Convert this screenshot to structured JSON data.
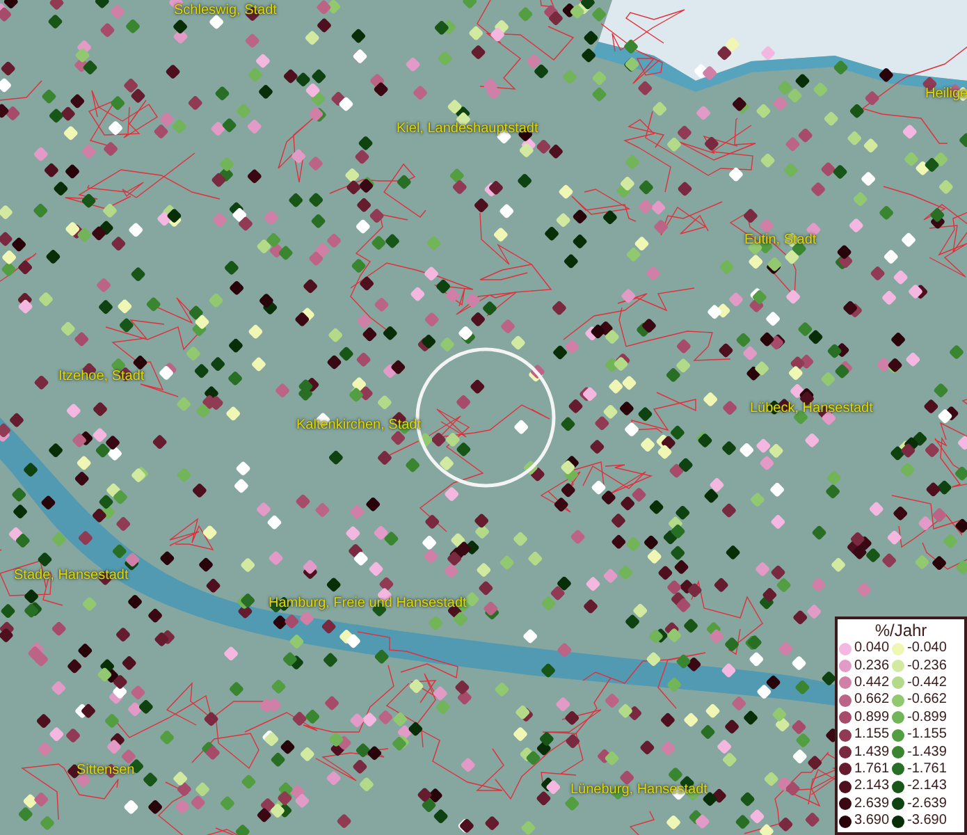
{
  "map": {
    "places": [
      {
        "name": "Schleswig, Stadt"
      },
      {
        "name": "Kiel, Landeshauptstadt"
      },
      {
        "name": "Heilige"
      },
      {
        "name": "Eutin, Stadt"
      },
      {
        "name": "Itzehoe, Stadt"
      },
      {
        "name": "Kaltenkirchen, Stadt"
      },
      {
        "name": "Lübeck, Hansestadt"
      },
      {
        "name": "Stade, Hansestadt"
      },
      {
        "name": "Hamburg, Freie und Hansestadt"
      },
      {
        "name": "Sittensen"
      },
      {
        "name": "Lüneburg, Hansestadt"
      }
    ]
  },
  "legend": {
    "title": "%/Jahr",
    "positive": [
      {
        "value": "0.040",
        "color": "#f4b8e0"
      },
      {
        "value": "0.236",
        "color": "#e29ac6"
      },
      {
        "value": "0.442",
        "color": "#d080a6"
      },
      {
        "value": "0.662",
        "color": "#bc6486"
      },
      {
        "value": "0.899",
        "color": "#a64c6a"
      },
      {
        "value": "1.155",
        "color": "#903a54"
      },
      {
        "value": "1.439",
        "color": "#7a2a40"
      },
      {
        "value": "1.761",
        "color": "#641c2e"
      },
      {
        "value": "2.143",
        "color": "#4e101e"
      },
      {
        "value": "2.639",
        "color": "#3a0812"
      },
      {
        "value": "3.690",
        "color": "#28040a"
      }
    ],
    "negative": [
      {
        "value": "-0.040",
        "color": "#f0f6b4"
      },
      {
        "value": "-0.236",
        "color": "#d2eaa0"
      },
      {
        "value": "-0.442",
        "color": "#b2da88"
      },
      {
        "value": "-0.662",
        "color": "#92c870"
      },
      {
        "value": "-0.899",
        "color": "#72b458"
      },
      {
        "value": "-1.155",
        "color": "#529e40"
      },
      {
        "value": "-1.439",
        "color": "#3a8630"
      },
      {
        "value": "-1.761",
        "color": "#286e24"
      },
      {
        "value": "-2.143",
        "color": "#185618"
      },
      {
        "value": "-2.639",
        "color": "#0e4210"
      },
      {
        "value": "-3.690",
        "color": "#082e08"
      }
    ]
  }
}
